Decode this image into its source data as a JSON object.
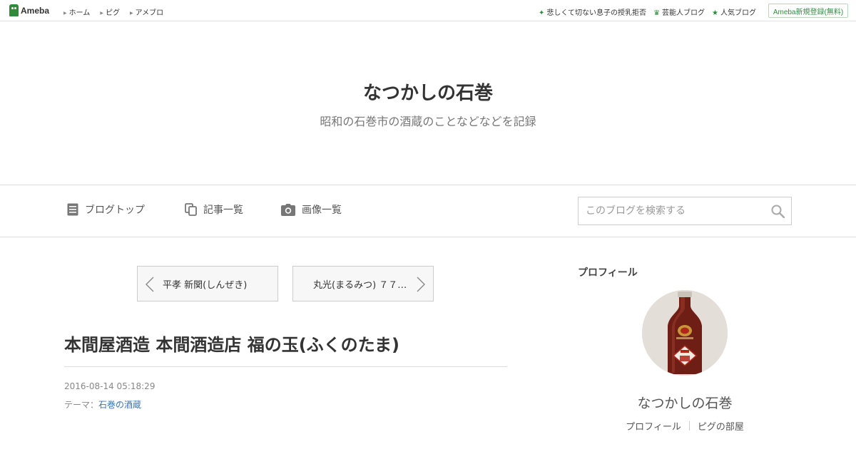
{
  "topbar": {
    "logo_text": "Ameba",
    "nav": [
      {
        "label": "ホーム"
      },
      {
        "label": "ピグ"
      },
      {
        "label": "アメブロ"
      }
    ],
    "right_links": [
      {
        "label": "悲しくて切ない息子の授乳拒否",
        "icon": "sparkle-icon"
      },
      {
        "label": "芸能人ブログ",
        "icon": "crown-icon"
      },
      {
        "label": "人気ブログ",
        "icon": "star-icon"
      }
    ],
    "signup_label": "Ameba新規登録(無料)"
  },
  "header": {
    "title": "なつかしの石巻",
    "description": "昭和の石巻市の酒蔵のことなどなどを記録"
  },
  "nav": {
    "items": [
      {
        "label": "ブログトップ",
        "icon": "document-icon"
      },
      {
        "label": "記事一覧",
        "icon": "copy-icon"
      },
      {
        "label": "画像一覧",
        "icon": "camera-icon"
      }
    ],
    "search_placeholder": "このブログを検索する"
  },
  "pager": {
    "prev_label": "平孝 新関(しんぜき)",
    "next_label": "丸光(まるみつ) ７７…"
  },
  "entry": {
    "title": "本間屋酒造 本間酒造店 福の玉(ふくのたま)",
    "date": "2016-08-14 05:18:29",
    "theme_prefix": "テーマ：",
    "theme_link": "石巻の酒蔵"
  },
  "sidebar": {
    "heading": "プロフィール",
    "profile_name": "なつかしの石巻",
    "links": [
      {
        "label": "プロフィール"
      },
      {
        "label": "ピグの部屋"
      }
    ]
  },
  "colors": {
    "brand": "#2d8c3c",
    "link": "#3b73b4"
  }
}
